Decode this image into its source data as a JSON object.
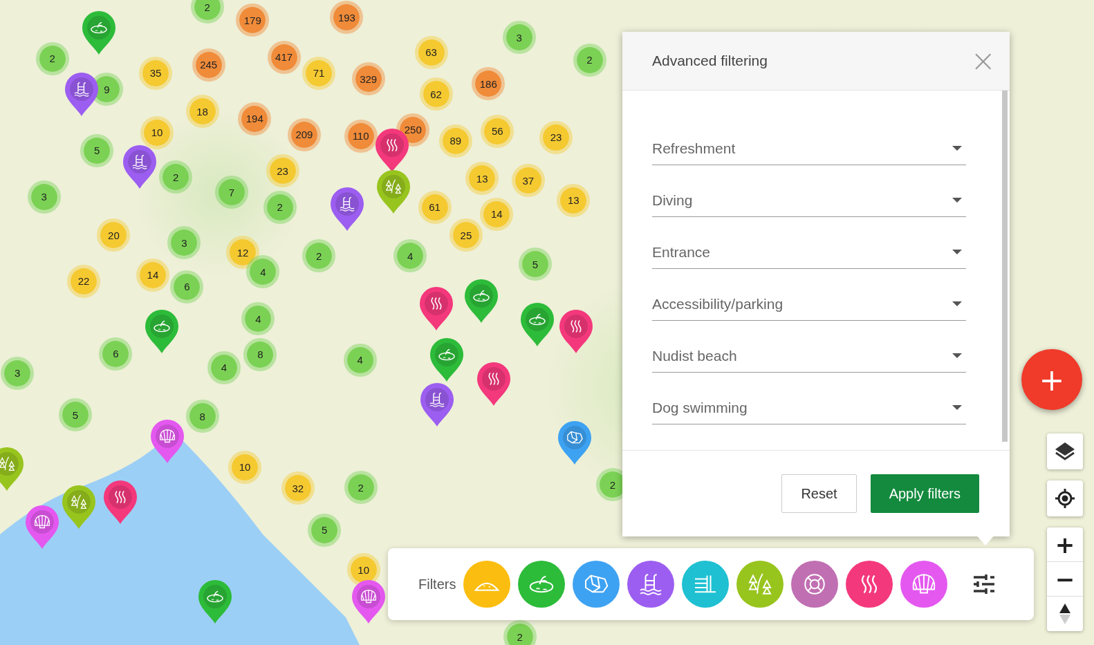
{
  "map": {
    "clusters": [
      {
        "count": "2",
        "kind": "small"
      },
      {
        "count": "179",
        "kind": "large"
      },
      {
        "count": "193",
        "kind": "large"
      },
      {
        "count": "3",
        "kind": "small"
      },
      {
        "count": "63",
        "kind": "medium"
      },
      {
        "count": "2",
        "kind": "small"
      },
      {
        "count": "245",
        "kind": "large"
      },
      {
        "count": "417",
        "kind": "large"
      },
      {
        "count": "2",
        "kind": "small"
      },
      {
        "count": "35",
        "kind": "medium"
      },
      {
        "count": "71",
        "kind": "medium"
      },
      {
        "count": "329",
        "kind": "large"
      },
      {
        "count": "186",
        "kind": "large"
      },
      {
        "count": "9",
        "kind": "small"
      },
      {
        "count": "62",
        "kind": "medium"
      },
      {
        "count": "18",
        "kind": "medium"
      },
      {
        "count": "194",
        "kind": "large"
      },
      {
        "count": "10",
        "kind": "medium"
      },
      {
        "count": "209",
        "kind": "large"
      },
      {
        "count": "110",
        "kind": "large"
      },
      {
        "count": "250",
        "kind": "large"
      },
      {
        "count": "89",
        "kind": "medium"
      },
      {
        "count": "56",
        "kind": "medium"
      },
      {
        "count": "23",
        "kind": "medium"
      },
      {
        "count": "5",
        "kind": "small"
      },
      {
        "count": "23",
        "kind": "medium"
      },
      {
        "count": "2",
        "kind": "small"
      },
      {
        "count": "13",
        "kind": "medium"
      },
      {
        "count": "37",
        "kind": "medium"
      },
      {
        "count": "3",
        "kind": "small"
      },
      {
        "count": "7",
        "kind": "small"
      },
      {
        "count": "2",
        "kind": "small"
      },
      {
        "count": "61",
        "kind": "medium"
      },
      {
        "count": "13",
        "kind": "medium"
      },
      {
        "count": "14",
        "kind": "medium"
      },
      {
        "count": "20",
        "kind": "medium"
      },
      {
        "count": "3",
        "kind": "small"
      },
      {
        "count": "25",
        "kind": "medium"
      },
      {
        "count": "12",
        "kind": "medium"
      },
      {
        "count": "2",
        "kind": "small"
      },
      {
        "count": "4",
        "kind": "small"
      },
      {
        "count": "5",
        "kind": "small"
      },
      {
        "count": "22",
        "kind": "medium"
      },
      {
        "count": "14",
        "kind": "medium"
      },
      {
        "count": "6",
        "kind": "small"
      },
      {
        "count": "4",
        "kind": "small"
      },
      {
        "count": "4",
        "kind": "small"
      },
      {
        "count": "6",
        "kind": "small"
      },
      {
        "count": "8",
        "kind": "small"
      },
      {
        "count": "4",
        "kind": "small"
      },
      {
        "count": "3",
        "kind": "small"
      },
      {
        "count": "4",
        "kind": "small"
      },
      {
        "count": "5",
        "kind": "small"
      },
      {
        "count": "8",
        "kind": "small"
      },
      {
        "count": "10",
        "kind": "medium"
      },
      {
        "count": "32",
        "kind": "medium"
      },
      {
        "count": "2",
        "kind": "small"
      },
      {
        "count": "2",
        "kind": "small"
      },
      {
        "count": "5",
        "kind": "small"
      },
      {
        "count": "10",
        "kind": "medium"
      },
      {
        "count": "2",
        "kind": "small"
      }
    ],
    "pins": [
      {
        "kind": "lake"
      },
      {
        "kind": "pool"
      },
      {
        "kind": "pool"
      },
      {
        "kind": "pool"
      },
      {
        "kind": "spa"
      },
      {
        "kind": "forest"
      },
      {
        "kind": "spa"
      },
      {
        "kind": "lake"
      },
      {
        "kind": "lake"
      },
      {
        "kind": "spa"
      },
      {
        "kind": "lake"
      },
      {
        "kind": "lake"
      },
      {
        "kind": "spa"
      },
      {
        "kind": "pool"
      },
      {
        "kind": "rocks"
      },
      {
        "kind": "shell"
      },
      {
        "kind": "forest"
      },
      {
        "kind": "shell"
      },
      {
        "kind": "forest"
      },
      {
        "kind": "spa"
      },
      {
        "kind": "lake"
      },
      {
        "kind": "shell"
      }
    ]
  },
  "dialog": {
    "title": "Advanced filtering",
    "close": "×",
    "fields": [
      {
        "placeholder": "Refreshment"
      },
      {
        "placeholder": "Diving"
      },
      {
        "placeholder": "Entrance"
      },
      {
        "placeholder": "Accessibility/parking"
      },
      {
        "placeholder": "Nudist beach"
      },
      {
        "placeholder": "Dog swimming"
      }
    ],
    "buttons": [
      {
        "label": "Reset",
        "kind": "secondary"
      },
      {
        "label": "Apply filters",
        "kind": "primary"
      }
    ]
  },
  "filter_bar": {
    "label": "Filters",
    "filters": [
      {
        "kind": "sand",
        "color": "#fbbd0f"
      },
      {
        "kind": "lake",
        "color": "#2dbb3a"
      },
      {
        "kind": "rocks",
        "color": "#3ea2f2"
      },
      {
        "kind": "pool",
        "color": "#9c5ef0"
      },
      {
        "kind": "waterfall",
        "color": "#1ec0d2"
      },
      {
        "kind": "forest",
        "color": "#98c41e"
      },
      {
        "kind": "lifebuoy",
        "color": "#c06fb2"
      },
      {
        "kind": "spa",
        "color": "#f4387c"
      },
      {
        "kind": "shell",
        "color": "#e458f0"
      }
    ]
  },
  "controls": {
    "add": "+",
    "zoom_in": "+",
    "zoom_out": "−"
  }
}
